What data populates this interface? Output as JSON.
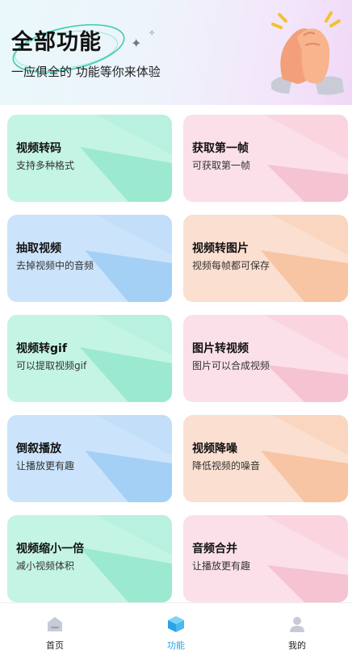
{
  "header": {
    "title": "全部功能",
    "subtitle": "一应俱全的 功能等你来体验"
  },
  "features": [
    {
      "title": "视频转码",
      "desc": "支持多种格式"
    },
    {
      "title": "获取第一帧",
      "desc": "可获取第一帧"
    },
    {
      "title": "抽取视频",
      "desc": "去掉视频中的音频"
    },
    {
      "title": "视频转图片",
      "desc": "视频每帧都可保存"
    },
    {
      "title": "视频转gif",
      "desc": "可以提取视频gif"
    },
    {
      "title": "图片转视频",
      "desc": "图片可以合成视频"
    },
    {
      "title": "倒叙播放",
      "desc": "让播放更有趣"
    },
    {
      "title": "视频降噪",
      "desc": "降低视频的噪音"
    },
    {
      "title": "视频缩小一倍",
      "desc": "减小视频体积"
    },
    {
      "title": "音频合并",
      "desc": "让播放更有趣"
    }
  ],
  "tabbar": {
    "home": "首页",
    "features": "功能",
    "mine": "我的",
    "active": "features"
  },
  "colors": {
    "teal": "#c4f4e4",
    "blue": "#cbe4fb",
    "pink": "#fbe0e9",
    "peach": "#fbdfd0",
    "accent": "#2aa3e6"
  },
  "icons": {
    "header_art": "clapping-hands-icon",
    "home": "home-icon",
    "features": "cube-icon",
    "mine": "user-icon"
  }
}
